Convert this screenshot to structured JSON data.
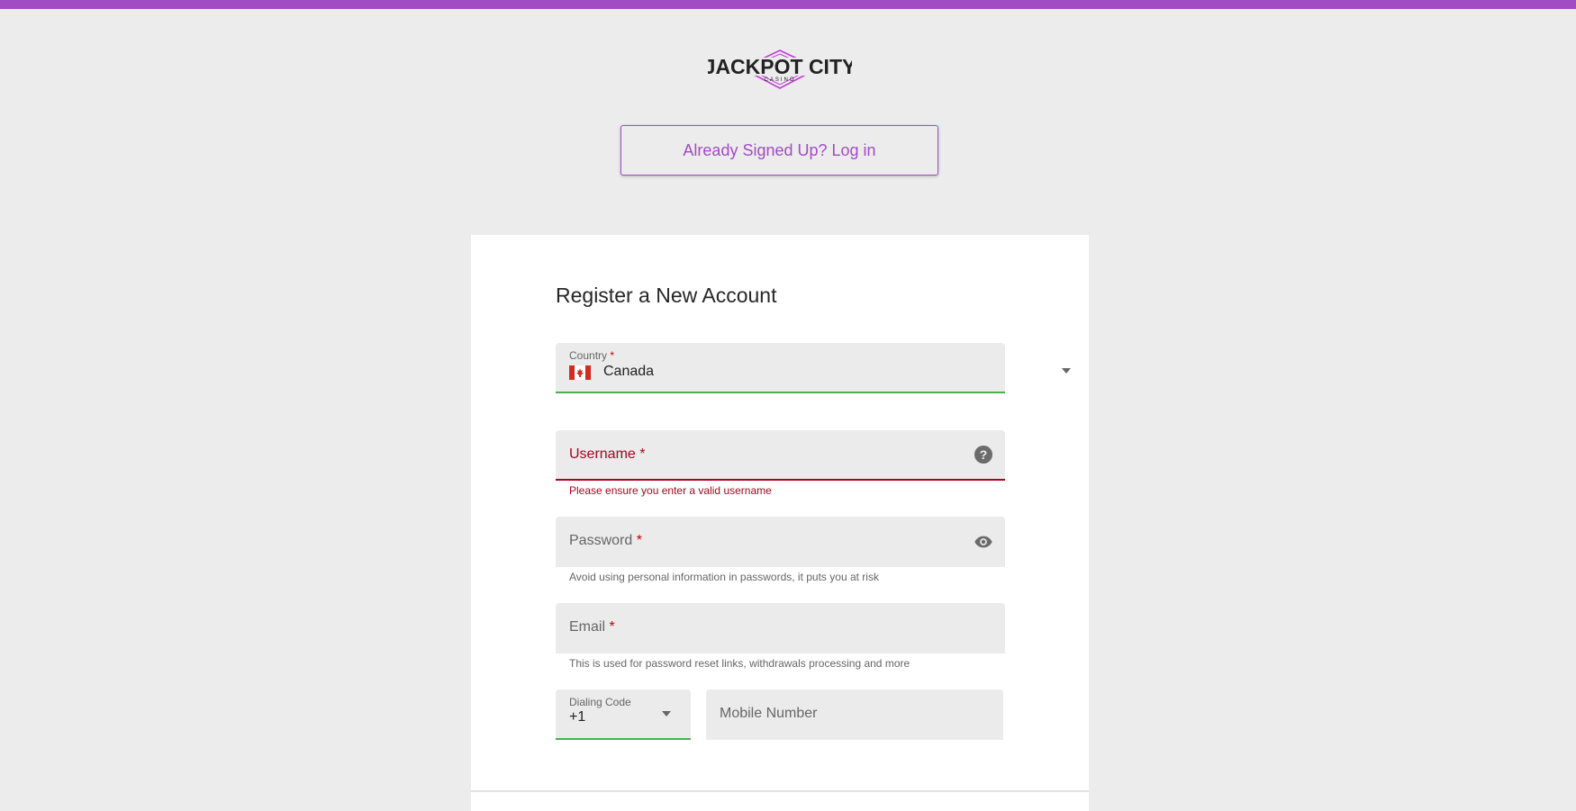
{
  "brand": {
    "logo_text_line1": "JACKPOT CITY",
    "logo_text_line2": "CASINO",
    "accent_color": "#a24cc4"
  },
  "header": {
    "login_button_label": "Already Signed Up? Log in"
  },
  "form": {
    "title": "Register a New Account",
    "required_mark": "*",
    "country": {
      "label": "Country",
      "value": "Canada",
      "flag_icon": "canada-flag-icon"
    },
    "username": {
      "label": "Username",
      "error": "Please ensure you enter a valid username",
      "help_icon": "help-circle-icon"
    },
    "password": {
      "label": "Password",
      "helper": "Avoid using personal information in passwords, it puts you at risk",
      "visibility_icon": "eye-icon"
    },
    "email": {
      "label": "Email",
      "helper": "This is used for password reset links, withdrawals processing and more"
    },
    "dialing_code": {
      "label": "Dialing Code",
      "value": "+1"
    },
    "mobile": {
      "label": "Mobile Number"
    }
  },
  "colors": {
    "valid": "#4caf50",
    "error": "#b00020",
    "field_bg": "#ebebeb",
    "page_bg": "#ececec"
  }
}
